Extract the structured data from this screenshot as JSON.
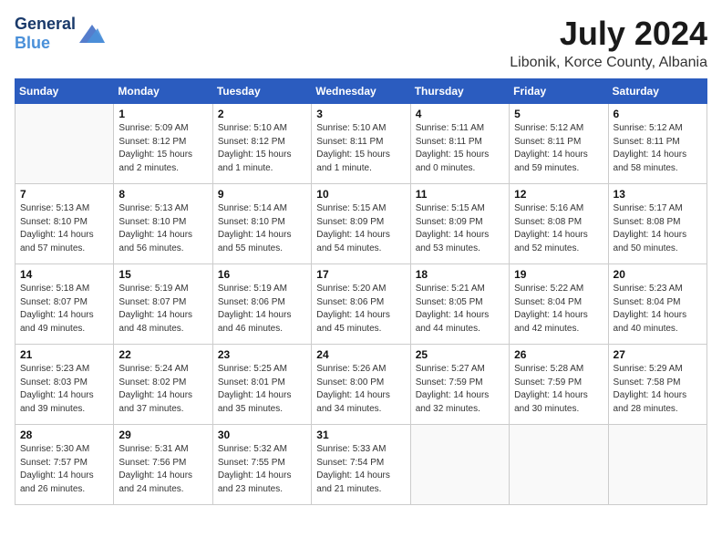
{
  "header": {
    "logo_general": "General",
    "logo_blue": "Blue",
    "month_title": "July 2024",
    "location": "Libonik, Korce County, Albania"
  },
  "weekdays": [
    "Sunday",
    "Monday",
    "Tuesday",
    "Wednesday",
    "Thursday",
    "Friday",
    "Saturday"
  ],
  "weeks": [
    [
      {
        "day": "",
        "info": ""
      },
      {
        "day": "1",
        "info": "Sunrise: 5:09 AM\nSunset: 8:12 PM\nDaylight: 15 hours\nand 2 minutes."
      },
      {
        "day": "2",
        "info": "Sunrise: 5:10 AM\nSunset: 8:12 PM\nDaylight: 15 hours\nand 1 minute."
      },
      {
        "day": "3",
        "info": "Sunrise: 5:10 AM\nSunset: 8:11 PM\nDaylight: 15 hours\nand 1 minute."
      },
      {
        "day": "4",
        "info": "Sunrise: 5:11 AM\nSunset: 8:11 PM\nDaylight: 15 hours\nand 0 minutes."
      },
      {
        "day": "5",
        "info": "Sunrise: 5:12 AM\nSunset: 8:11 PM\nDaylight: 14 hours\nand 59 minutes."
      },
      {
        "day": "6",
        "info": "Sunrise: 5:12 AM\nSunset: 8:11 PM\nDaylight: 14 hours\nand 58 minutes."
      }
    ],
    [
      {
        "day": "7",
        "info": "Sunrise: 5:13 AM\nSunset: 8:10 PM\nDaylight: 14 hours\nand 57 minutes."
      },
      {
        "day": "8",
        "info": "Sunrise: 5:13 AM\nSunset: 8:10 PM\nDaylight: 14 hours\nand 56 minutes."
      },
      {
        "day": "9",
        "info": "Sunrise: 5:14 AM\nSunset: 8:10 PM\nDaylight: 14 hours\nand 55 minutes."
      },
      {
        "day": "10",
        "info": "Sunrise: 5:15 AM\nSunset: 8:09 PM\nDaylight: 14 hours\nand 54 minutes."
      },
      {
        "day": "11",
        "info": "Sunrise: 5:15 AM\nSunset: 8:09 PM\nDaylight: 14 hours\nand 53 minutes."
      },
      {
        "day": "12",
        "info": "Sunrise: 5:16 AM\nSunset: 8:08 PM\nDaylight: 14 hours\nand 52 minutes."
      },
      {
        "day": "13",
        "info": "Sunrise: 5:17 AM\nSunset: 8:08 PM\nDaylight: 14 hours\nand 50 minutes."
      }
    ],
    [
      {
        "day": "14",
        "info": "Sunrise: 5:18 AM\nSunset: 8:07 PM\nDaylight: 14 hours\nand 49 minutes."
      },
      {
        "day": "15",
        "info": "Sunrise: 5:19 AM\nSunset: 8:07 PM\nDaylight: 14 hours\nand 48 minutes."
      },
      {
        "day": "16",
        "info": "Sunrise: 5:19 AM\nSunset: 8:06 PM\nDaylight: 14 hours\nand 46 minutes."
      },
      {
        "day": "17",
        "info": "Sunrise: 5:20 AM\nSunset: 8:06 PM\nDaylight: 14 hours\nand 45 minutes."
      },
      {
        "day": "18",
        "info": "Sunrise: 5:21 AM\nSunset: 8:05 PM\nDaylight: 14 hours\nand 44 minutes."
      },
      {
        "day": "19",
        "info": "Sunrise: 5:22 AM\nSunset: 8:04 PM\nDaylight: 14 hours\nand 42 minutes."
      },
      {
        "day": "20",
        "info": "Sunrise: 5:23 AM\nSunset: 8:04 PM\nDaylight: 14 hours\nand 40 minutes."
      }
    ],
    [
      {
        "day": "21",
        "info": "Sunrise: 5:23 AM\nSunset: 8:03 PM\nDaylight: 14 hours\nand 39 minutes."
      },
      {
        "day": "22",
        "info": "Sunrise: 5:24 AM\nSunset: 8:02 PM\nDaylight: 14 hours\nand 37 minutes."
      },
      {
        "day": "23",
        "info": "Sunrise: 5:25 AM\nSunset: 8:01 PM\nDaylight: 14 hours\nand 35 minutes."
      },
      {
        "day": "24",
        "info": "Sunrise: 5:26 AM\nSunset: 8:00 PM\nDaylight: 14 hours\nand 34 minutes."
      },
      {
        "day": "25",
        "info": "Sunrise: 5:27 AM\nSunset: 7:59 PM\nDaylight: 14 hours\nand 32 minutes."
      },
      {
        "day": "26",
        "info": "Sunrise: 5:28 AM\nSunset: 7:59 PM\nDaylight: 14 hours\nand 30 minutes."
      },
      {
        "day": "27",
        "info": "Sunrise: 5:29 AM\nSunset: 7:58 PM\nDaylight: 14 hours\nand 28 minutes."
      }
    ],
    [
      {
        "day": "28",
        "info": "Sunrise: 5:30 AM\nSunset: 7:57 PM\nDaylight: 14 hours\nand 26 minutes."
      },
      {
        "day": "29",
        "info": "Sunrise: 5:31 AM\nSunset: 7:56 PM\nDaylight: 14 hours\nand 24 minutes."
      },
      {
        "day": "30",
        "info": "Sunrise: 5:32 AM\nSunset: 7:55 PM\nDaylight: 14 hours\nand 23 minutes."
      },
      {
        "day": "31",
        "info": "Sunrise: 5:33 AM\nSunset: 7:54 PM\nDaylight: 14 hours\nand 21 minutes."
      },
      {
        "day": "",
        "info": ""
      },
      {
        "day": "",
        "info": ""
      },
      {
        "day": "",
        "info": ""
      }
    ]
  ]
}
